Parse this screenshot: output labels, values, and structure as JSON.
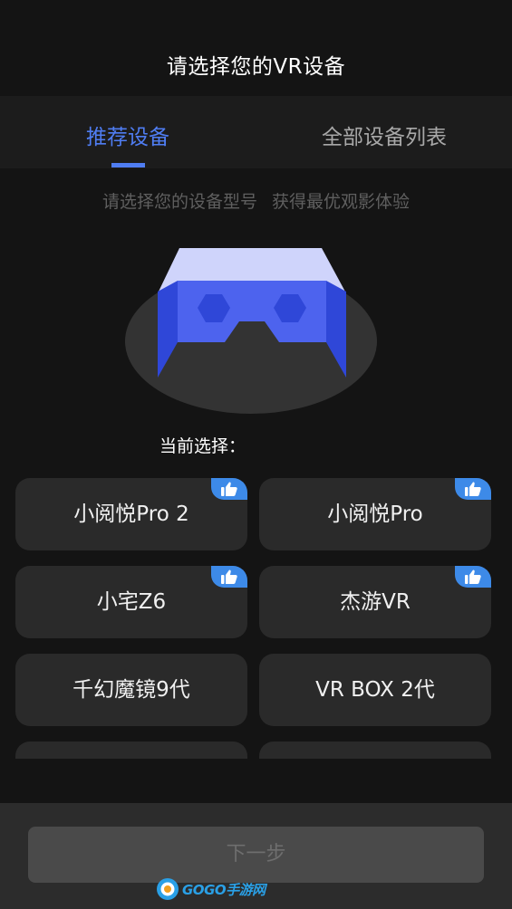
{
  "header": {
    "title": "请选择您的VR设备"
  },
  "tabs": [
    {
      "label": "推荐设备",
      "active": true
    },
    {
      "label": "全部设备列表",
      "active": false
    }
  ],
  "subtitle": "请选择您的设备型号 获得最优观影体验",
  "illustration": {
    "icon": "vr-headset-icon"
  },
  "current_selection": {
    "label": "当前选择："
  },
  "devices": [
    {
      "name": "小阅悦Pro 2",
      "recommended": true
    },
    {
      "name": "小阅悦Pro",
      "recommended": true
    },
    {
      "name": "小宅Z6",
      "recommended": true
    },
    {
      "name": "杰游VR",
      "recommended": true
    },
    {
      "name": "千幻魔镜9代",
      "recommended": false
    },
    {
      "name": "VR BOX 2代",
      "recommended": false
    },
    {
      "name": "",
      "recommended": false
    },
    {
      "name": "",
      "recommended": false
    }
  ],
  "bottom": {
    "next_label": "下一步"
  },
  "watermark": {
    "text": "GOGO手游网"
  },
  "colors": {
    "background": "#141414",
    "tab_bar": "#1c1c1c",
    "accent": "#4f7df2",
    "card": "#2a2a2a",
    "badge": "#3d8ae8",
    "disabled_button": "#4a4a4a"
  }
}
